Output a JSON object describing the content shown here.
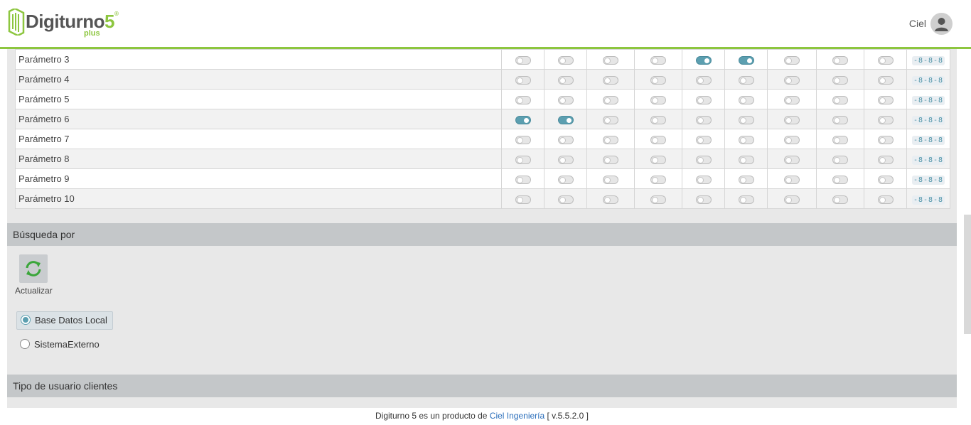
{
  "header": {
    "logo_text": "Digiturno",
    "logo_five": "5",
    "logo_reg": "®",
    "logo_plus": "plus",
    "user_name": "Ciel"
  },
  "params_table": {
    "rows": [
      {
        "name": "Parámetro 3",
        "toggles": [
          false,
          false,
          false,
          false,
          true,
          true,
          false,
          false,
          false
        ]
      },
      {
        "name": "Parámetro 4",
        "toggles": [
          false,
          false,
          false,
          false,
          false,
          false,
          false,
          false,
          false
        ]
      },
      {
        "name": "Parámetro 5",
        "toggles": [
          false,
          false,
          false,
          false,
          false,
          false,
          false,
          false,
          false
        ]
      },
      {
        "name": "Parámetro 6",
        "toggles": [
          true,
          true,
          false,
          false,
          false,
          false,
          false,
          false,
          false
        ]
      },
      {
        "name": "Parámetro 7",
        "toggles": [
          false,
          false,
          false,
          false,
          false,
          false,
          false,
          false,
          false
        ]
      },
      {
        "name": "Parámetro 8",
        "toggles": [
          false,
          false,
          false,
          false,
          false,
          false,
          false,
          false,
          false
        ]
      },
      {
        "name": "Parámetro 9",
        "toggles": [
          false,
          false,
          false,
          false,
          false,
          false,
          false,
          false,
          false
        ]
      },
      {
        "name": "Parámetro 10",
        "toggles": [
          false,
          false,
          false,
          false,
          false,
          false,
          false,
          false,
          false
        ]
      }
    ],
    "action_icons": "-8-8-8"
  },
  "busqueda": {
    "title": "Búsqueda por",
    "refresh_label": "Actualizar",
    "options": [
      {
        "label": "Base Datos Local",
        "checked": true
      },
      {
        "label": "SistemaExterno",
        "checked": false
      }
    ]
  },
  "tipo_usuario": {
    "title": "Tipo de usuario clientes"
  },
  "footer": {
    "prefix": "Digiturno 5 es un producto de ",
    "link": "Ciel Ingeniería",
    "suffix": " [ v.5.5.2.0 ]"
  },
  "colors": {
    "brand_green": "#8dc63f",
    "toggle_on": "#5c9fb0",
    "link": "#2a6ebb"
  }
}
